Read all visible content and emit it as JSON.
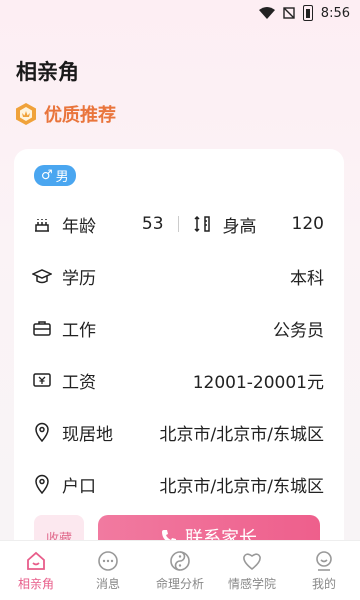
{
  "status": {
    "time": "8:56"
  },
  "page": {
    "title": "相亲角"
  },
  "section": {
    "title": "优质推荐"
  },
  "profile": {
    "gender": "男",
    "age_label": "年龄",
    "age": "53",
    "height_label": "身高",
    "height": "120",
    "education_label": "学历",
    "education": "本科",
    "job_label": "工作",
    "job": "公务员",
    "salary_label": "工资",
    "salary": "12001-20001元",
    "residence_label": "现居地",
    "residence": "北京市/北京市/东城区",
    "hukou_label": "户口",
    "hukou": "北京市/北京市/东城区"
  },
  "actions": {
    "favorite": "收藏",
    "contact": "联系家长"
  },
  "tabs": [
    {
      "label": "相亲角",
      "icon": "home-icon",
      "active": true
    },
    {
      "label": "消息",
      "icon": "message-icon",
      "active": false
    },
    {
      "label": "命理分析",
      "icon": "yin-yang-icon",
      "active": false
    },
    {
      "label": "情感学院",
      "icon": "heart-icon",
      "active": false
    },
    {
      "label": "我的",
      "icon": "profile-icon",
      "active": false
    }
  ],
  "colors": {
    "accent": "#e85d8a",
    "orange": "#e9753c",
    "male_blue": "#4aa6f0"
  }
}
